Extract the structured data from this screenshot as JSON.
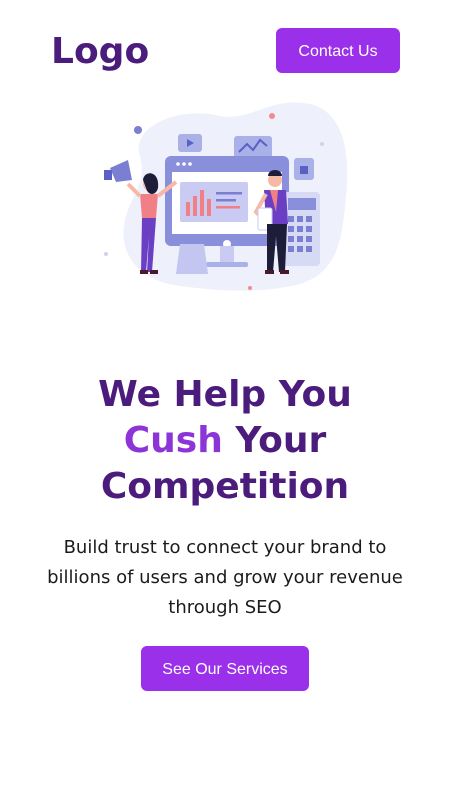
{
  "header": {
    "logo_text": "Logo",
    "contact_label": "Contact Us"
  },
  "hero": {
    "illustration_icon": "marketing-analytics-illustration",
    "headline_line1": "We Help You",
    "headline_accent": "Cush",
    "headline_line2_rest": "Your",
    "headline_line3": "Competition",
    "description": "Build trust to connect your brand to billions of users and grow your revenue through SEO",
    "cta_label": "See Our Services"
  },
  "colors": {
    "brand_dark": "#4c1c7c",
    "brand_accent": "#8c34d8",
    "button_bg": "#9b30ea",
    "text": "#1b1b1b"
  }
}
